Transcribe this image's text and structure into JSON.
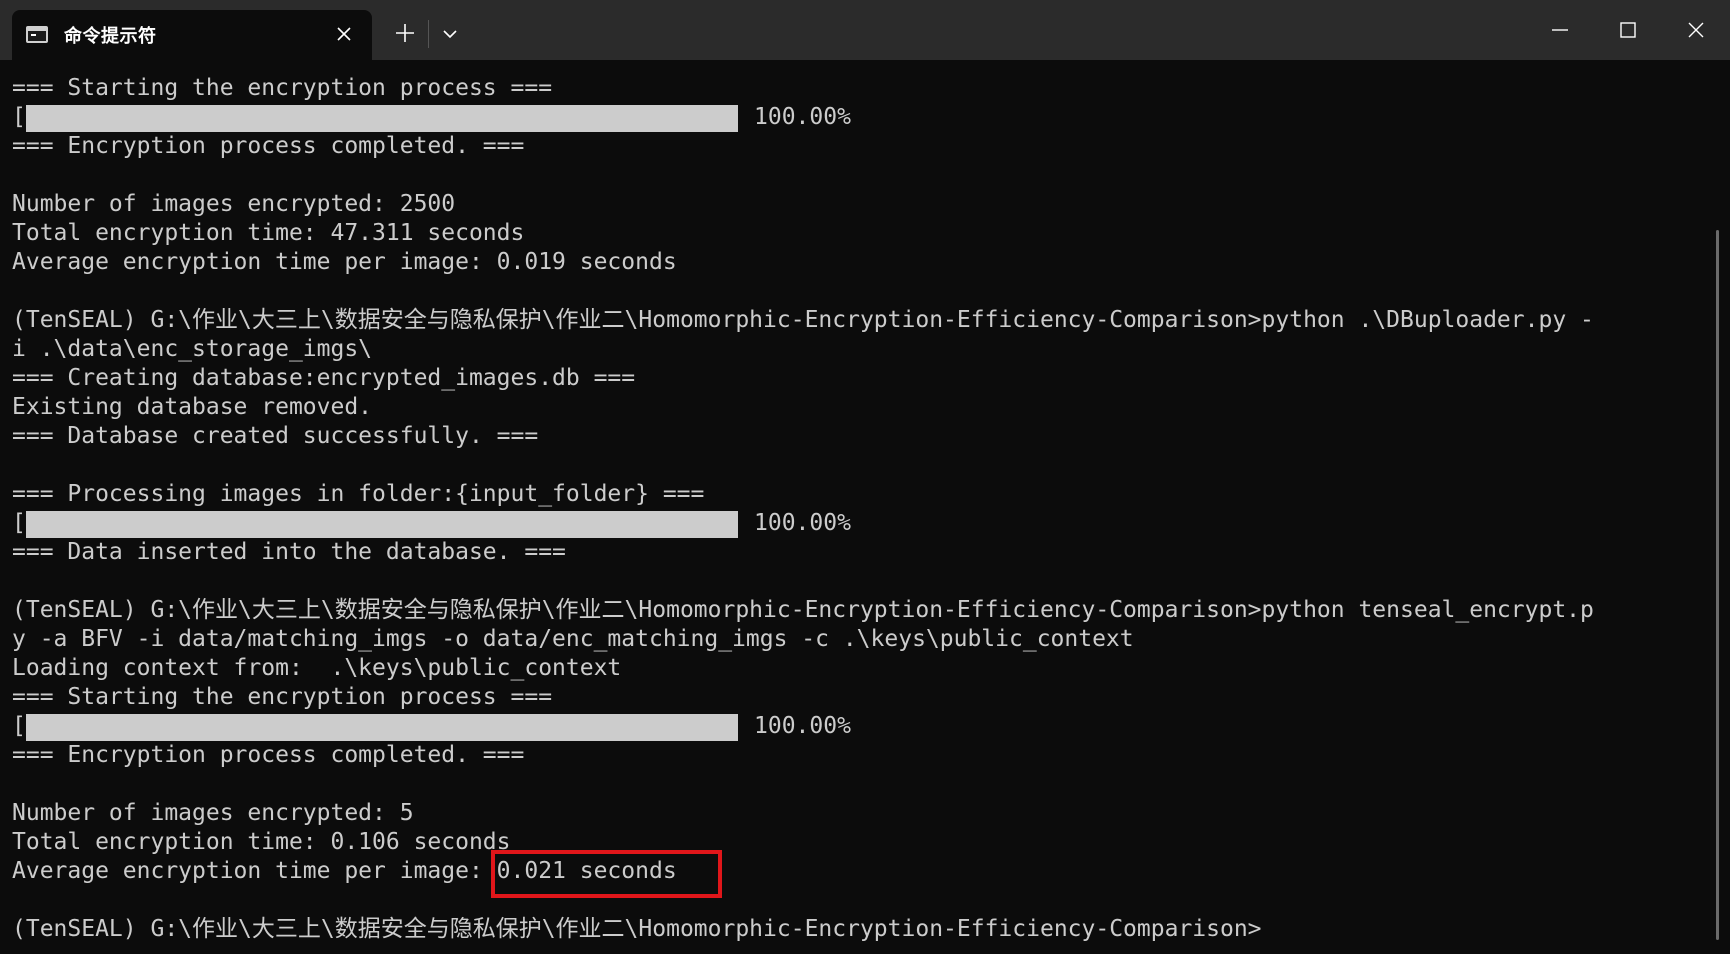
{
  "window": {
    "tab_title": "命令提示符",
    "tab_icon": "terminal-icon",
    "new_tab_icon": "plus-icon",
    "dropdown_icon": "chevron-down-icon",
    "tab_close_icon": "close-icon",
    "minimize_icon": "minimize-icon",
    "maximize_icon": "maximize-icon",
    "close_icon": "close-icon"
  },
  "terminal": {
    "lines": [
      "=== Starting the encryption process ===",
      "",
      "=== Encryption process completed. ===",
      "",
      "Number of images encrypted: 2500",
      "Total encryption time: 47.311 seconds",
      "Average encryption time per image: 0.019 seconds",
      "",
      "(TenSEAL) G:\\作业\\大三上\\数据安全与隐私保护\\作业二\\Homomorphic-Encryption-Efficiency-Comparison>python .\\DBuploader.py -",
      "i .\\data\\enc_storage_imgs\\",
      "=== Creating database:encrypted_images.db ===",
      "Existing database removed.",
      "=== Database created successfully. ===",
      "",
      "=== Processing images in folder:{input_folder} ===",
      "",
      "=== Data inserted into the database. ===",
      "",
      "(TenSEAL) G:\\作业\\大三上\\数据安全与隐私保护\\作业二\\Homomorphic-Encryption-Efficiency-Comparison>python tenseal_encrypt.p",
      "y -a BFV -i data/matching_imgs -o data/enc_matching_imgs -c .\\keys\\public_context",
      "Loading context from:  .\\keys\\public_context",
      "=== Starting the encryption process ===",
      "",
      "=== Encryption process completed. ===",
      "",
      "Number of images encrypted: 5",
      "Total encryption time: 0.106 seconds",
      "Average encryption time per image: 0.021 seconds",
      "",
      "(TenSEAL) G:\\作业\\大三上\\数据安全与隐私保护\\作业二\\Homomorphic-Encryption-Efficiency-Comparison>"
    ],
    "progress_bars": [
      {
        "open": "[",
        "close": "]",
        "percent_text": "100.00%",
        "progress": 1.0
      },
      {
        "open": "[",
        "close": "]",
        "percent_text": "100.00%",
        "progress": 1.0
      },
      {
        "open": "[",
        "close": "]",
        "percent_text": "100.00%",
        "progress": 1.0
      }
    ]
  },
  "colors": {
    "background": "#0c0c0c",
    "titlebar": "#2b2b2b",
    "text": "#cccccc",
    "highlight_border": "#e0161a"
  }
}
